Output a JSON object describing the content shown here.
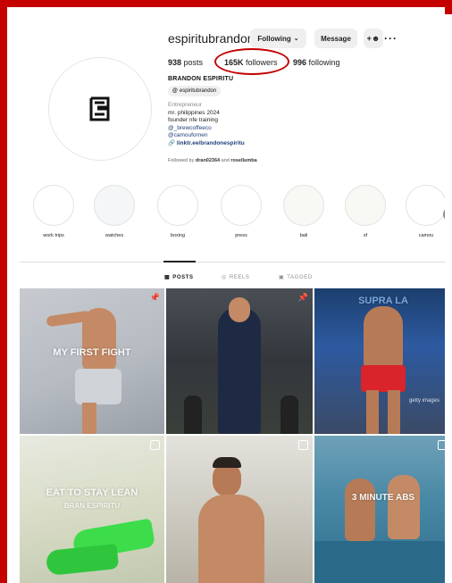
{
  "profile": {
    "username": "espiritubrandon",
    "following_label": "Following",
    "message_label": "Message",
    "posts_count": "938",
    "posts_label": "posts",
    "followers_count": "165K",
    "followers_label": "followers",
    "following_count": "996",
    "following_count_label": "following",
    "full_name": "BRANDON ESPIRITU",
    "threads_handle": "espiritubrandon",
    "category": "Entrepreneur",
    "bio_line1": "mr. philippines 2024",
    "bio_line2": "founder nfe training",
    "bio_tag1": "@_brewcoffeeco",
    "bio_tag2": "@camoufornen",
    "bio_link": "linktr.ee/brandonespiritu",
    "followed_by_prefix": "Followed by",
    "followed_by_user1": "dran02364",
    "followed_by_and": "and",
    "followed_by_user2": "rosellumba"
  },
  "highlights": [
    {
      "label": "work trips"
    },
    {
      "label": "watches"
    },
    {
      "label": "boxing"
    },
    {
      "label": "press"
    },
    {
      "label": "bali"
    },
    {
      "label": "sf"
    },
    {
      "label": "camou"
    }
  ],
  "tabs": {
    "posts": "POSTS",
    "reels": "REELS",
    "tagged": "TAGGED"
  },
  "posts": {
    "p1_overlay": "MY FIRST FIGHT",
    "p3_overlay": "SUPRA LA",
    "p3_watermark": "getty images",
    "p4_overlay_line1": "EAT TO STAY LEAN",
    "p4_overlay_line2": "BRAN ESPIRITU",
    "p6_overlay": "3 MINUTE ABS"
  },
  "colors": {
    "annotation_red": "#c40000",
    "link_blue": "#1f3f7a",
    "button_gray": "#efefef"
  }
}
